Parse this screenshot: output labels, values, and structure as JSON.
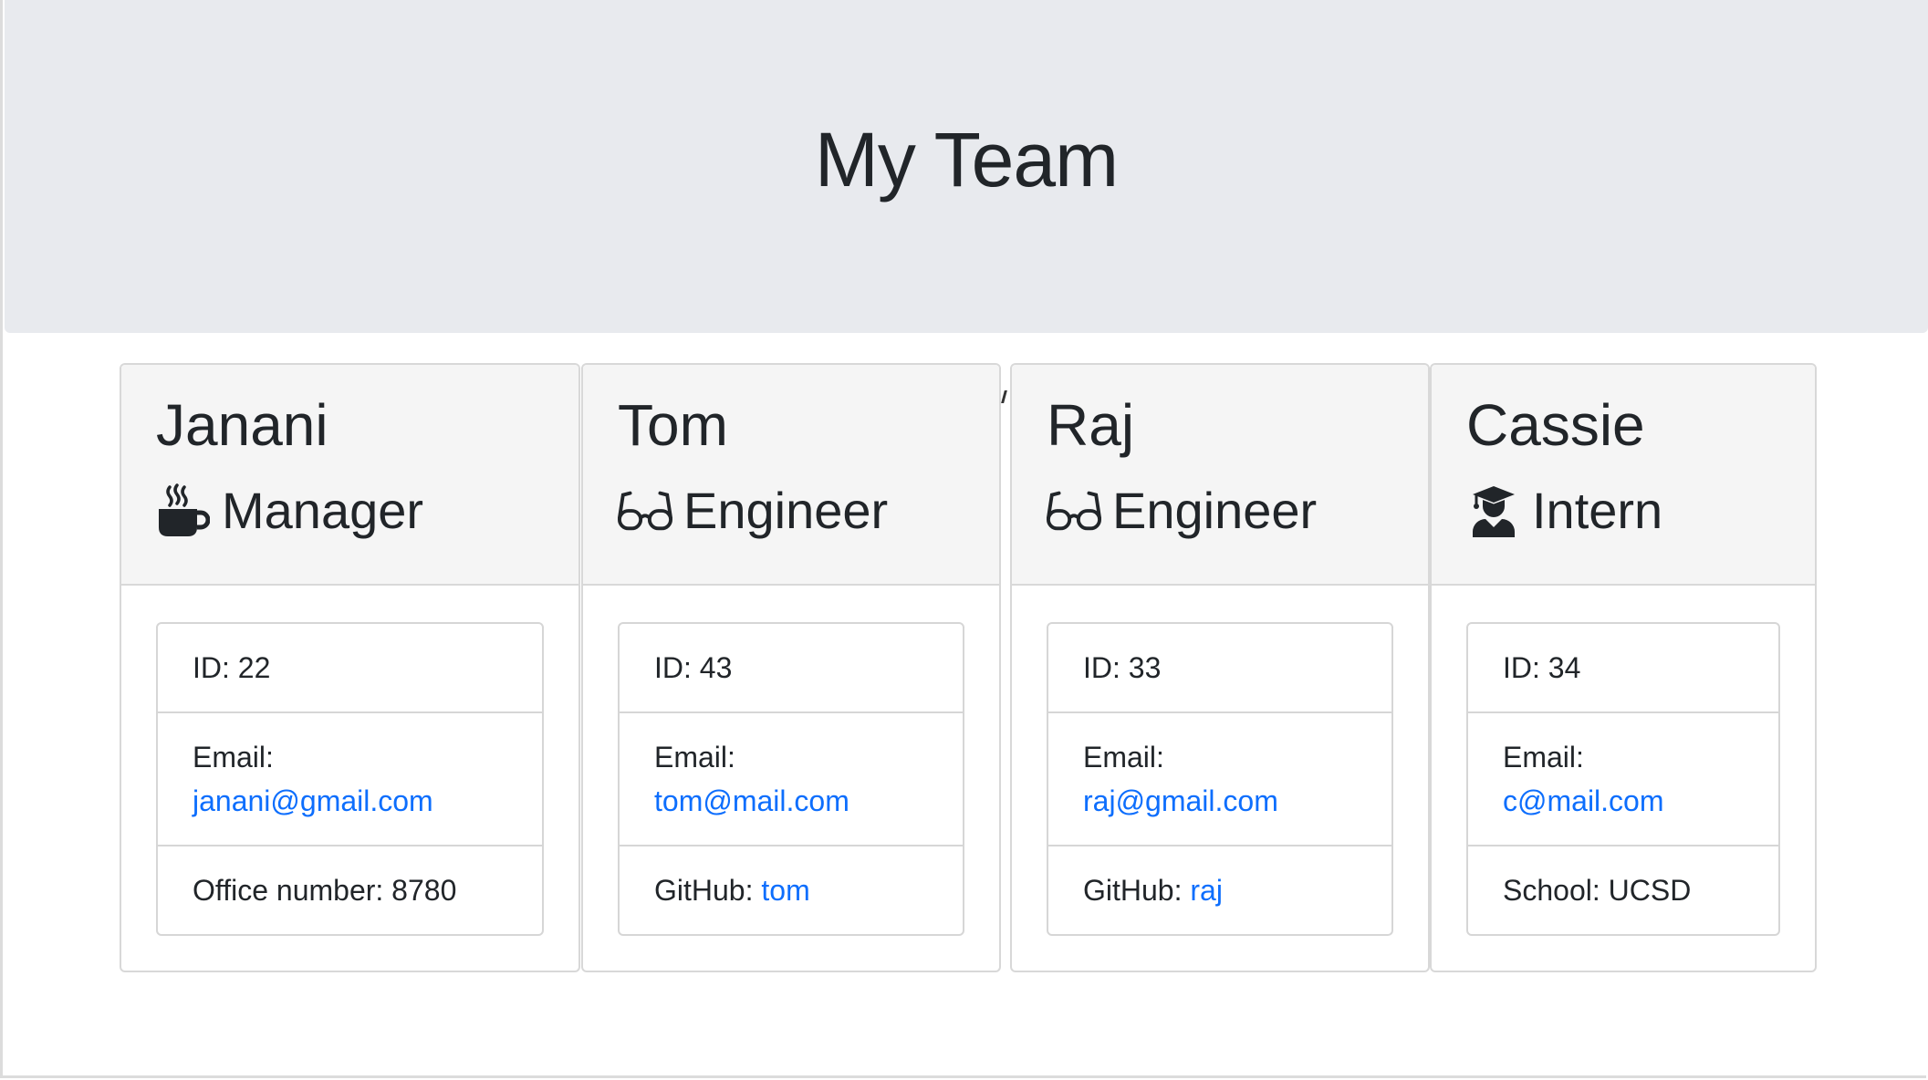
{
  "header": {
    "title": "My Team"
  },
  "team": [
    {
      "name": "Janani",
      "role": "Manager",
      "icon": "coffee-mug-icon",
      "id_text": "ID: 22",
      "email_label": "Email:",
      "email": "janani@gmail.com",
      "extra_label": "Office number: 8780",
      "extra_link": ""
    },
    {
      "name": "Tom",
      "role": "Engineer",
      "icon": "glasses-icon",
      "id_text": "ID: 43",
      "email_label": "Email:",
      "email": "tom@mail.com",
      "extra_label": "GitHub: ",
      "extra_link": "tom"
    },
    {
      "name": "Raj",
      "role": "Engineer",
      "icon": "glasses-icon",
      "id_text": "ID: 33",
      "email_label": "Email:",
      "email": "raj@gmail.com",
      "extra_label": "GitHub: ",
      "extra_link": "raj"
    },
    {
      "name": "Cassie",
      "role": "Intern",
      "icon": "graduate-icon",
      "id_text": "ID: 34",
      "email_label": "Email:",
      "email": "c@mail.com",
      "extra_label": "School: UCSD",
      "extra_link": ""
    }
  ],
  "colors": {
    "jumbotron_bg": "#e8eaee",
    "card_header_bg": "#f5f5f5",
    "link": "#0d6efd",
    "text": "#212529"
  }
}
